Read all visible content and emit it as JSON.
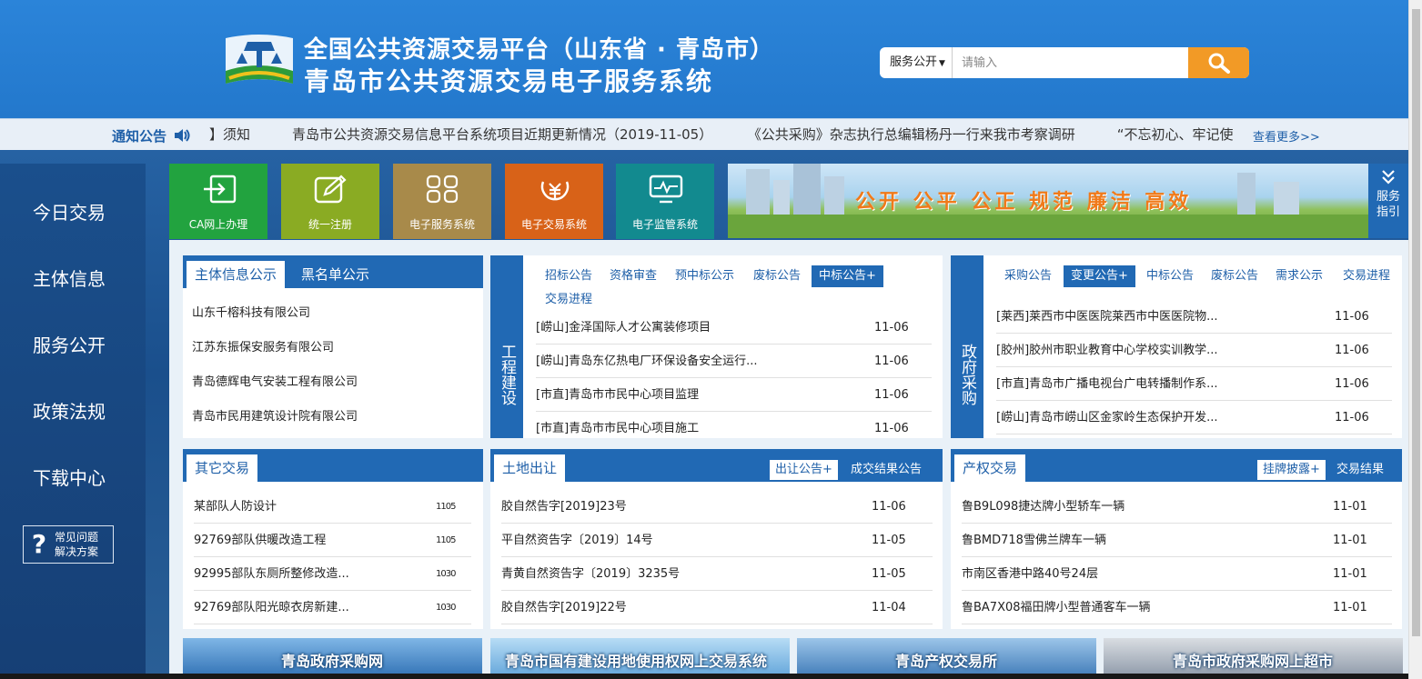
{
  "header": {
    "title_line1": "全国公共资源交易平台（山东省 · 青岛市）",
    "title_line2": "青岛市公共资源交易电子服务系统",
    "search_select": "服务公开",
    "search_placeholder": "请输入"
  },
  "notice": {
    "label": "通知公告",
    "items": [
      "】须知",
      "青岛市公共资源交易信息平台系统项目近期更新情况（2019-11-05）",
      "《公共采购》杂志执行总编辑杨丹一行来我市考察调研",
      "“不忘初心、牢记使"
    ],
    "more": "查看更多>>"
  },
  "sidebar": {
    "items": [
      "今日交易",
      "主体信息",
      "服务公开",
      "政策法规",
      "下载中心"
    ],
    "faq_line1": "常见问题",
    "faq_line2": "解决方案"
  },
  "tiles": [
    {
      "label": "CA网上办理",
      "color": "#22a33f",
      "icon": "login-icon"
    },
    {
      "label": "统一注册",
      "color": "#8aab23",
      "icon": "edit-icon"
    },
    {
      "label": "电子服务系统",
      "color": "#a88a4a",
      "icon": "apps-icon"
    },
    {
      "label": "电子交易系统",
      "color": "#d86218",
      "icon": "yen-icon"
    },
    {
      "label": "电子监管系统",
      "color": "#128a8f",
      "icon": "monitor-icon"
    }
  ],
  "banner": {
    "slogan": "公开 公平 公正   规范 廉洁 高效"
  },
  "guide": {
    "line1": "服务",
    "line2": "指引"
  },
  "panels": {
    "entity": {
      "tabs": [
        "主体信息公示",
        "黑名单公示"
      ],
      "rows": [
        "山东千榕科技有限公司",
        "江苏东振保安服务有限公司",
        "青岛德辉电气安装工程有限公司",
        "青岛市民用建筑设计院有限公司"
      ]
    },
    "engineering": {
      "vlabel": "工程建设",
      "subtabs": [
        "招标公告",
        "资格审查",
        "预中标公示",
        "废标公告",
        "中标公告+",
        "交易进程"
      ],
      "rows": [
        {
          "title": "[崂山]金泽国际人才公寓装修项目",
          "date": "11-06"
        },
        {
          "title": "[崂山]青岛东亿热电厂环保设备安全运行...",
          "date": "11-06"
        },
        {
          "title": "[市直]青岛市市民中心项目监理",
          "date": "11-06"
        },
        {
          "title": "[市直]青岛市市民中心项目施工",
          "date": "11-06"
        }
      ]
    },
    "procurement": {
      "vlabel": "政府采购",
      "subtabs": [
        "采购公告",
        "变更公告+",
        "中标公告",
        "废标公告",
        "需求公示",
        "交易进程"
      ],
      "rows": [
        {
          "title": "[莱西]莱西市中医医院莱西市中医医院物...",
          "date": "11-06"
        },
        {
          "title": "[胶州]胶州市职业教育中心学校实训教学...",
          "date": "11-06"
        },
        {
          "title": "[市直]青岛市广播电视台广电转播制作系...",
          "date": "11-06"
        },
        {
          "title": "[崂山]青岛市崂山区金家岭生态保护开发...",
          "date": "11-06"
        }
      ]
    },
    "other": {
      "tab": "其它交易",
      "rows": [
        {
          "title": "某部队人防设计",
          "date": "1105"
        },
        {
          "title": "92769部队供暖改造工程",
          "date": "1105"
        },
        {
          "title": "92995部队东厕所整修改造...",
          "date": "1030"
        },
        {
          "title": "92769部队阳光晾衣房新建...",
          "date": "1030"
        }
      ]
    },
    "land": {
      "tab": "土地出让",
      "btn_on": "出让公告+",
      "btn_off": "成交结果公告",
      "rows": [
        {
          "title": "胶自然告字[2019]23号",
          "date": "11-06"
        },
        {
          "title": "平自然资告字〔2019〕14号",
          "date": "11-05"
        },
        {
          "title": "青黄自然资告字〔2019〕3235号",
          "date": "11-05"
        },
        {
          "title": "胶自然告字[2019]22号",
          "date": "11-04"
        }
      ]
    },
    "property": {
      "tab": "产权交易",
      "btn_on": "挂牌披露+",
      "btn_off": "交易结果",
      "rows": [
        {
          "title": "鲁B9L098捷达牌小型轿车一辆",
          "date": "11-01"
        },
        {
          "title": "鲁BMD718雪佛兰牌车一辆",
          "date": "11-01"
        },
        {
          "title": "市南区香港中路40号24层",
          "date": "11-01"
        },
        {
          "title": "鲁BA7X08福田牌小型普通客车一辆",
          "date": "11-01"
        }
      ]
    }
  },
  "links": [
    "青岛政府采购网",
    "青岛市国有建设用地使用权网上交易系统",
    "青岛产权交易所",
    "青岛市政府采购网上超市"
  ]
}
